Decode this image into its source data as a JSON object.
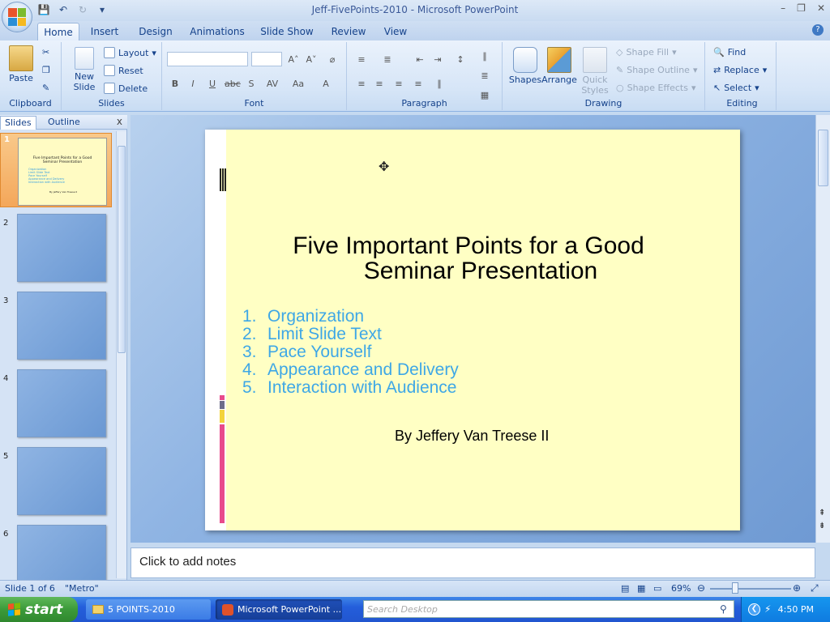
{
  "window": {
    "title": "Jeff-FivePoints-2010 - Microsoft PowerPoint"
  },
  "tabs": [
    "Home",
    "Insert",
    "Design",
    "Animations",
    "Slide Show",
    "Review",
    "View"
  ],
  "ribbon": {
    "clipboard": {
      "label": "Clipboard",
      "paste": "Paste"
    },
    "slides": {
      "label": "Slides",
      "new_slide": "New",
      "new_slide2": "Slide",
      "layout": "Layout",
      "reset": "Reset",
      "delete": "Delete"
    },
    "font": {
      "label": "Font"
    },
    "paragraph": {
      "label": "Paragraph"
    },
    "drawing": {
      "label": "Drawing",
      "shapes": "Shapes",
      "arrange": "Arrange",
      "quick_styles": "Quick",
      "quick_styles2": "Styles",
      "shape_fill": "Shape Fill",
      "shape_outline": "Shape Outline",
      "shape_effects": "Shape Effects"
    },
    "editing": {
      "label": "Editing",
      "find": "Find",
      "replace": "Replace",
      "select": "Select"
    }
  },
  "left_pane": {
    "tab_slides": "Slides",
    "tab_outline": "Outline",
    "close": "x",
    "slide_numbers": [
      "1",
      "2",
      "3",
      "4",
      "5",
      "6"
    ]
  },
  "slide": {
    "title_line1": "Five Important Points for a Good",
    "title_line2": "Seminar Presentation",
    "items": [
      {
        "num": "1.",
        "text": "Organization"
      },
      {
        "num": "2.",
        "text": "Limit Slide Text"
      },
      {
        "num": "3.",
        "text": "Pace Yourself"
      },
      {
        "num": "4.",
        "text": "Appearance and Delivery"
      },
      {
        "num": "5.",
        "text": "Interaction with Audience"
      }
    ],
    "byline": "By Jeffery Van Treese II",
    "background_color": "#ffffc4",
    "list_color": "#3ea7e6"
  },
  "notes": {
    "placeholder": "Click to add notes"
  },
  "status": {
    "slide_of": "Slide 1 of 6",
    "theme": "\"Metro\"",
    "zoom": "69%"
  },
  "taskbar": {
    "start": "start",
    "folder": "5 POINTS-2010",
    "ppt": "Microsoft PowerPoint ...",
    "search_placeholder": "Search Desktop",
    "time": "4:50 PM"
  }
}
